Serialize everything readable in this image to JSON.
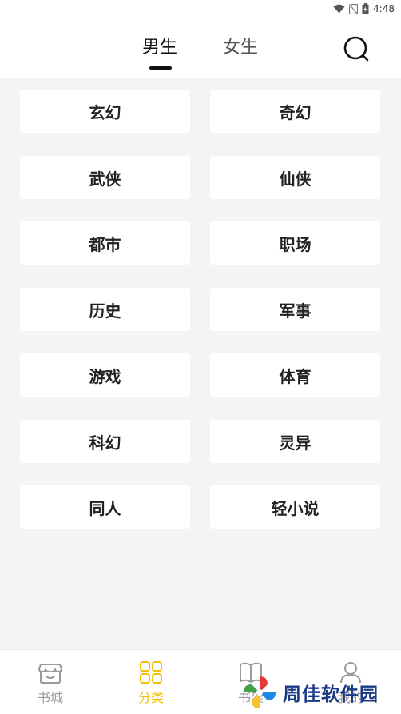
{
  "status_bar": {
    "time": "4:48",
    "icons": [
      "wifi-icon",
      "no-sim-icon",
      "battery-icon"
    ]
  },
  "header": {
    "tabs": [
      {
        "label": "男生",
        "active": true
      },
      {
        "label": "女生",
        "active": false
      }
    ],
    "search_icon": "search-icon"
  },
  "categories": [
    [
      "玄幻",
      "奇幻"
    ],
    [
      "武侠",
      "仙侠"
    ],
    [
      "都市",
      "职场"
    ],
    [
      "历史",
      "军事"
    ],
    [
      "游戏",
      "体育"
    ],
    [
      "科幻",
      "灵异"
    ],
    [
      "同人",
      "轻小说"
    ]
  ],
  "bottom_nav": {
    "items": [
      {
        "label": "书城",
        "icon": "bookstore-icon",
        "active": false
      },
      {
        "label": "分类",
        "icon": "category-grid-icon",
        "active": true
      },
      {
        "label": "书架",
        "icon": "bookshelf-icon",
        "active": false
      },
      {
        "label": "我的",
        "icon": "profile-icon",
        "active": false
      }
    ]
  },
  "watermark": {
    "text": "周佳软件园"
  },
  "colors": {
    "accent": "#f2c200",
    "background": "#f4f4f4",
    "card": "#ffffff",
    "watermark_text": "#1b3a84"
  }
}
